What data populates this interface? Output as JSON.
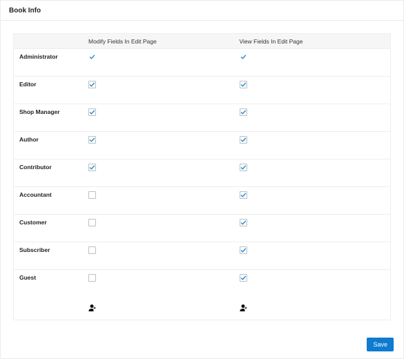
{
  "panel": {
    "title": "Book Info"
  },
  "columns": {
    "modify": "Modify Fields In Edit Page",
    "view": "View Fields In Edit Page"
  },
  "roles": [
    {
      "name": "Administrator",
      "modify_checked": true,
      "modify_locked": true,
      "view_checked": true,
      "view_locked": true
    },
    {
      "name": "Editor",
      "modify_checked": true,
      "modify_locked": false,
      "view_checked": true,
      "view_locked": false
    },
    {
      "name": "Shop Manager",
      "modify_checked": true,
      "modify_locked": false,
      "view_checked": true,
      "view_locked": false
    },
    {
      "name": "Author",
      "modify_checked": true,
      "modify_locked": false,
      "view_checked": true,
      "view_locked": false
    },
    {
      "name": "Contributor",
      "modify_checked": true,
      "modify_locked": false,
      "view_checked": true,
      "view_locked": false
    },
    {
      "name": "Accountant",
      "modify_checked": false,
      "modify_locked": false,
      "view_checked": true,
      "view_locked": false
    },
    {
      "name": "Customer",
      "modify_checked": false,
      "modify_locked": false,
      "view_checked": true,
      "view_locked": false
    },
    {
      "name": "Subscriber",
      "modify_checked": false,
      "modify_locked": false,
      "view_checked": true,
      "view_locked": false
    },
    {
      "name": "Guest",
      "modify_checked": false,
      "modify_locked": false,
      "view_checked": true,
      "view_locked": false
    }
  ],
  "buttons": {
    "save": "Save"
  },
  "icons": {
    "add_user": "add-user-icon"
  }
}
